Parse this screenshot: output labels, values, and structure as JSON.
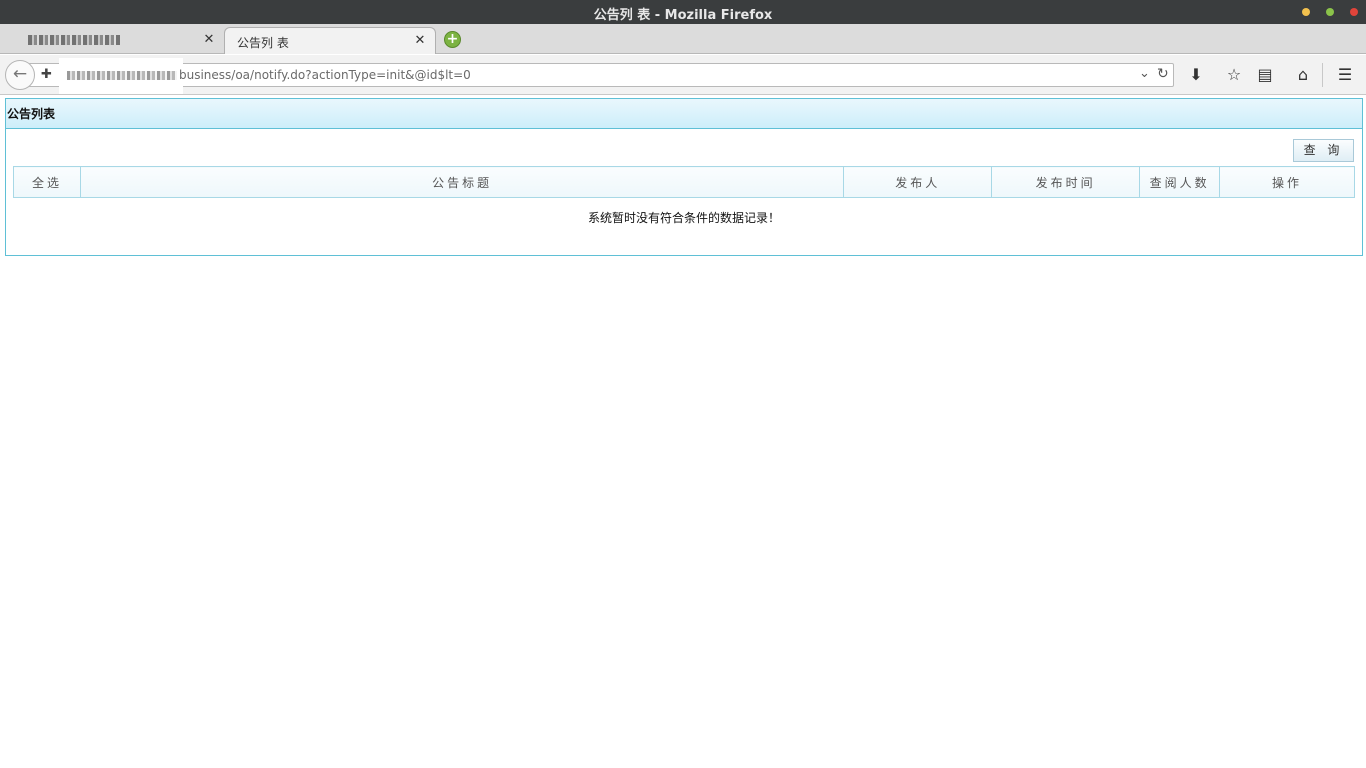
{
  "window": {
    "title": "公告列 表 - Mozilla Firefox"
  },
  "tabs": [
    {
      "label": "",
      "active": false
    },
    {
      "label": "公告列 表",
      "active": true
    }
  ],
  "navbar": {
    "url_visible": "business/oa/notify.do?actionType=init&@id$lt=0"
  },
  "panel": {
    "title": "公告列表",
    "query_button": "查 询",
    "table": {
      "columns": [
        "全选",
        "公告标题",
        "发布人",
        "发布时间",
        "查阅人数",
        "操作"
      ]
    },
    "empty_message": "系统暂时没有符合条件的数据记录！"
  },
  "colors": {
    "panel_border": "#5fc0d6",
    "header_bg": "#cdeefa",
    "titlebar_bg": "#3a3d3e"
  }
}
